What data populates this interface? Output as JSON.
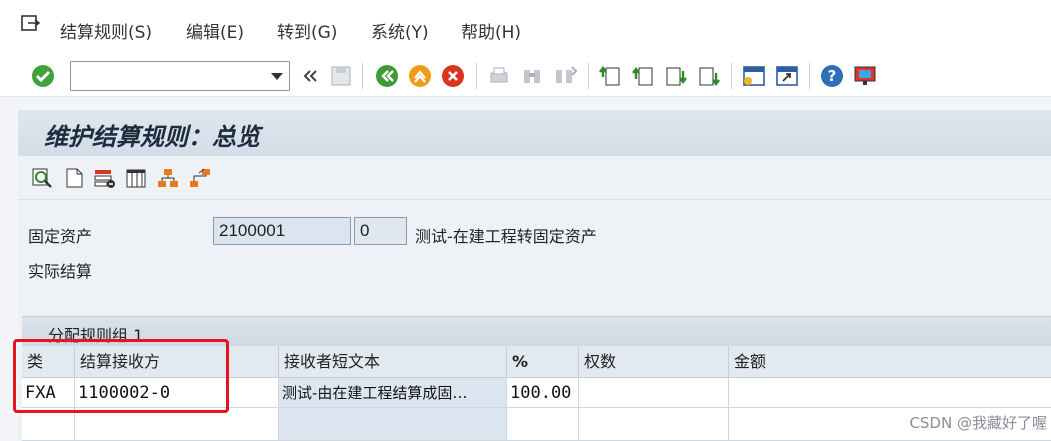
{
  "menu": {
    "items": [
      "结算规则(S)",
      "编辑(E)",
      "转到(G)",
      "系统(Y)",
      "帮助(H)"
    ]
  },
  "toolbar": {
    "command_field_value": "",
    "icons": [
      "check-icon",
      "back-double-icon",
      "save-icon",
      "back-icon",
      "exit-icon",
      "cancel-icon",
      "print-icon",
      "find-icon",
      "find-next-icon",
      "first-page-icon",
      "previous-page-icon",
      "next-page-icon",
      "last-page-icon",
      "create-session-icon",
      "shortcut-icon",
      "help-icon",
      "customize-layout-icon"
    ]
  },
  "page": {
    "title": "维护结算规则：总览"
  },
  "header": {
    "asset_label": "固定资产",
    "asset_number": "2100001",
    "asset_sub": "0",
    "asset_desc": "测试-在建工程转固定资产",
    "settlement_type": "实际结算"
  },
  "table": {
    "group_title": "分配规则组 1",
    "columns": [
      "类",
      "结算接收方",
      "接收者短文本",
      "%",
      "权数",
      "金额"
    ],
    "rows": [
      {
        "cat": "FXA",
        "receiver": "1100002-0",
        "short_text": "测试-由在建工程结算成固…",
        "percent": "100.00",
        "weight": "",
        "amount": ""
      }
    ]
  },
  "watermark": "CSDN @我藏好了喔",
  "colors": {
    "highlight": "#e8141d",
    "accent": "#1f2c3d"
  }
}
